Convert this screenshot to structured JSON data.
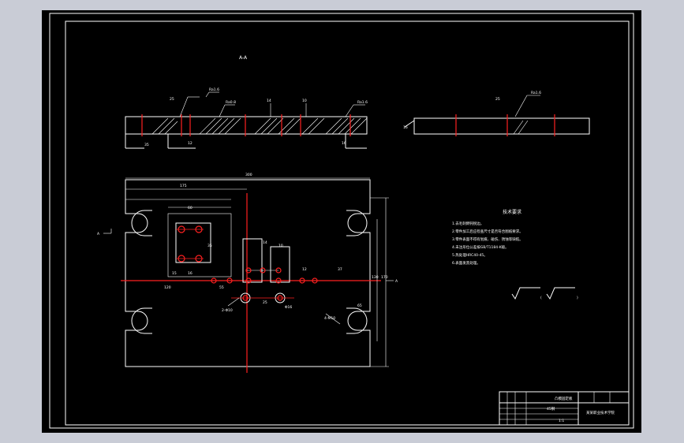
{
  "drawing": {
    "section_label": "A-A",
    "section_marker": "A",
    "width_dim": "300",
    "dim_175": "175",
    "dim_60": "60",
    "dim_15": "15",
    "dim_16": "16",
    "dim_35": "35",
    "dim_55": "55",
    "dim_14": "14",
    "dim_10": "10",
    "dim_12": "12",
    "dim_37": "37",
    "dim_65": "65",
    "dim_120": "120",
    "dim_170": "170",
    "dim_130": "130",
    "dim_25": "25",
    "dim_100": "100",
    "roughness": "Ra1.6",
    "roughness_b": "Ra0.8",
    "hole_a": "4-M10",
    "hole_b": "2-Φ10",
    "hole_c": "Φ16",
    "tech_title": "技术要求",
    "tech_notes": [
      "1.去毛刺倒钝锐边。",
      "2.零件加工后应检查尺寸是否符合图纸要求。",
      "3.零件表面不得有划痕、碰伤、锈蚀等缺陷。",
      "4.未注形位公差按GB/T1184-K级。",
      "5.热处理HRC40-45。",
      "6.表面发黑处理。"
    ],
    "title_block": {
      "part_name": "凸模固定板",
      "material": "45钢",
      "scale": "1:1",
      "school": "某某职业技术学院"
    }
  }
}
